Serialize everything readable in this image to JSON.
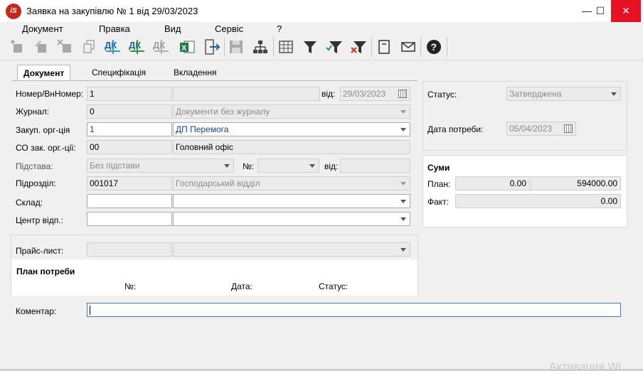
{
  "window": {
    "title": "Заявка на закупівлю № 1 від 29/03/2023",
    "app_icon_text": "iS",
    "minimize": "—",
    "maximize": "☐",
    "close": "✕"
  },
  "menu": [
    "Документ",
    "Правка",
    "Вид",
    "Сервіс",
    "?"
  ],
  "toolbar": {
    "icons": [
      "add-icon",
      "edit-icon",
      "delete-icon",
      "copy-icon",
      "debit-credit-icon",
      "debit-credit-green-icon",
      "debit-credit-gray-icon",
      "excel-export-icon",
      "exit-icon",
      "save-icon",
      "hierarchy-icon",
      "grid-icon",
      "filter-icon",
      "filter-apply-icon",
      "filter-clear-icon",
      "notebook-icon",
      "mail-icon",
      "help-icon"
    ],
    "dk_label": "ДК"
  },
  "tabs": [
    "Документ",
    "Специфікація",
    "Вкладення"
  ],
  "form": {
    "number_label": "Номер/ВнНомер:",
    "number_value": "1",
    "inner_number_value": "",
    "date_label": "від:",
    "date_value": "29/03/2023",
    "journal_label": "Журнал:",
    "journal_code": "0",
    "journal_name": "Документи без журналу",
    "org_label": "Закуп. орг-ція",
    "org_code": "1",
    "org_name": "ДП Перемога",
    "so_label": "СО зак. орг.-ції:",
    "so_code": "00",
    "so_name": "Головний офіс",
    "basis_label": "Підстава:",
    "basis_value": "Без підстави",
    "basis_num_label": "№:",
    "basis_num_value": "",
    "basis_date_label": "від:",
    "basis_date_value": "",
    "dept_label": "Підрозділ:",
    "dept_code": "001017",
    "dept_name": "Господарський відділ",
    "warehouse_label": "Склад:",
    "warehouse_code": "",
    "warehouse_name": "",
    "center_label": "Центр відп.:",
    "center_code": "",
    "center_name": ""
  },
  "pricelist": {
    "label": "Прайс-лист:",
    "code": "",
    "name": ""
  },
  "plan": {
    "title": "План потреби",
    "num_label": "№:",
    "date_label": "Дата:",
    "status_label": "Статус:"
  },
  "comment": {
    "label": "Коментар:",
    "value": ""
  },
  "status": {
    "label": "Статус:",
    "value": "Затверджена",
    "need_date_label": "Дата потреби:",
    "need_date_value": "05/04/2023"
  },
  "sums": {
    "title": "Суми",
    "plan_label": "План:",
    "plan_value1": "0.00",
    "plan_value2": "594000.00",
    "fact_label": "Факт:",
    "fact_value": "0.00"
  },
  "watermark": "Активация Wi"
}
